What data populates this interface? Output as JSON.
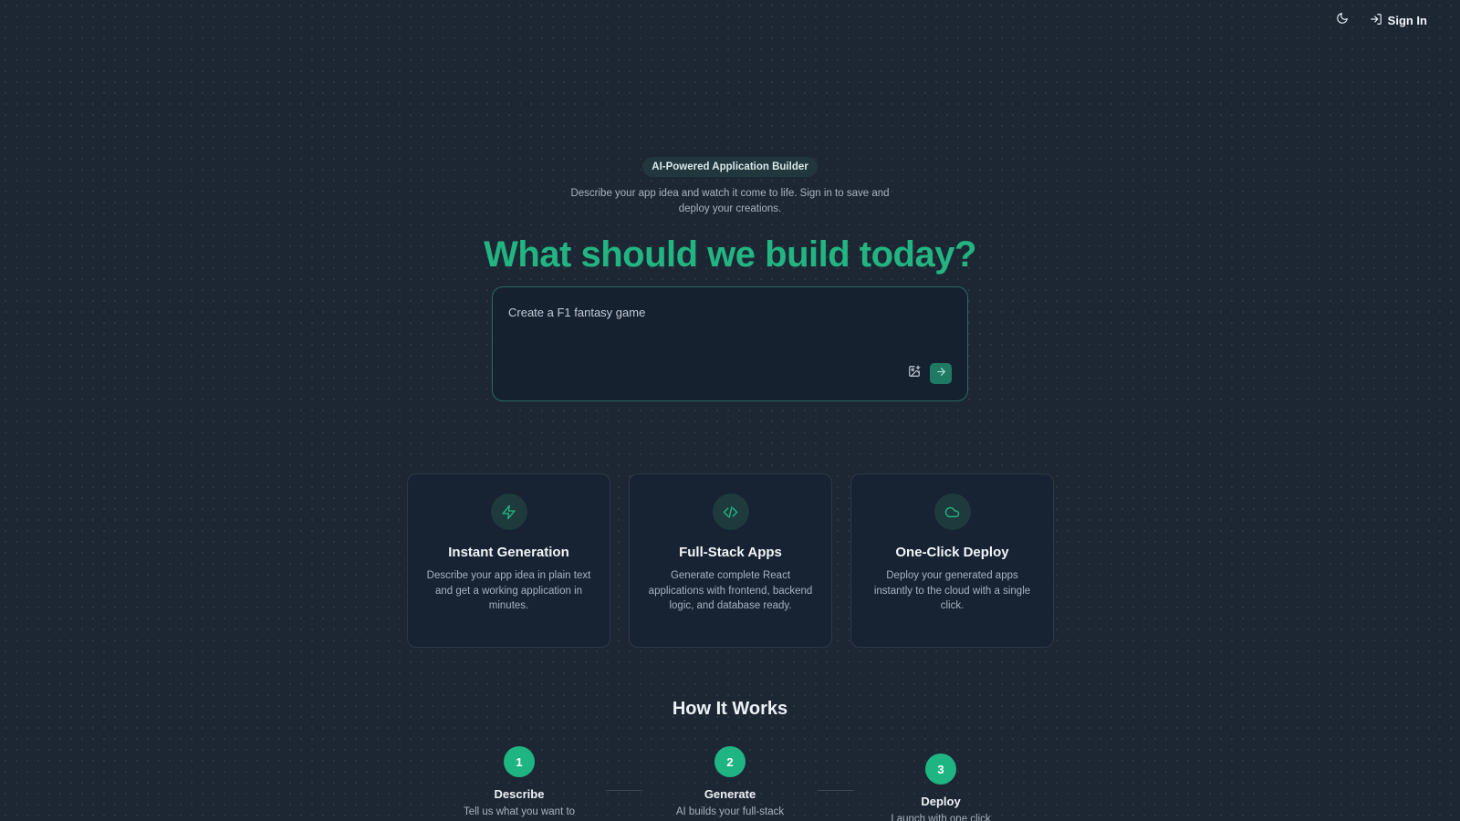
{
  "header": {
    "theme_icon": "moon-icon",
    "signin_icon": "log-in-icon",
    "signin_label": "Sign In"
  },
  "hero": {
    "badge": "AI-Powered Application Builder",
    "subtitle": "Describe your app idea and watch it come to life. Sign in to save and deploy your creations.",
    "headline": "What should we build today?",
    "prompt": {
      "value": "Create a F1 fantasy game",
      "image_icon": "image-plus-icon",
      "send_icon": "arrow-right-icon"
    }
  },
  "features": [
    {
      "icon": "zap-icon",
      "title": "Instant Generation",
      "description": "Describe your app idea in plain text and get a working application in minutes."
    },
    {
      "icon": "code-icon",
      "title": "Full-Stack Apps",
      "description": "Generate complete React applications with frontend, backend logic, and database ready."
    },
    {
      "icon": "cloud-icon",
      "title": "One-Click Deploy",
      "description": "Deploy your generated apps instantly to the cloud with a single click."
    }
  ],
  "how_it_works": {
    "title": "How It Works",
    "steps": [
      {
        "number": "1",
        "title": "Describe",
        "description": "Tell us what you want to"
      },
      {
        "number": "2",
        "title": "Generate",
        "description": "AI builds your full-stack"
      },
      {
        "number": "3",
        "title": "Deploy",
        "description": "Launch with one click"
      }
    ]
  },
  "colors": {
    "background": "#1d2734",
    "accent": "#22b582",
    "card": "#172232"
  }
}
